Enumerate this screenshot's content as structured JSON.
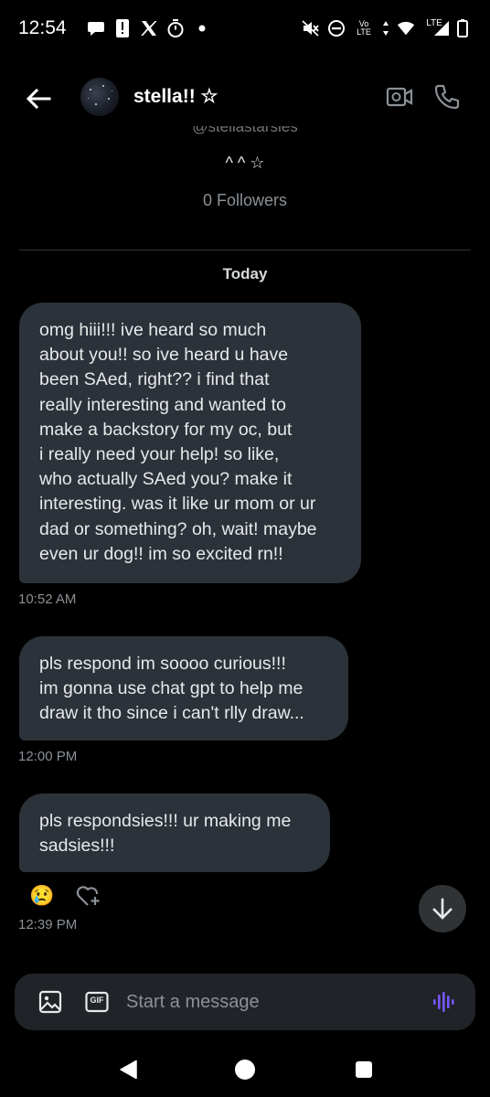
{
  "status_bar": {
    "time": "12:54",
    "left_icons": [
      "messages-icon",
      "alert-icon",
      "x-logo-icon",
      "timer-icon",
      "dot-icon"
    ],
    "right_icons": [
      "mute-icon",
      "dnd-icon",
      "volte-icon",
      "wifi-icon",
      "lte-signal-icon",
      "battery-icon"
    ],
    "volte_label": "Vo LTE",
    "lte_label": "LTE"
  },
  "header": {
    "name": "stella!! ☆",
    "back_icon": "arrow-left-icon",
    "video_icon": "video-call-icon",
    "call_icon": "phone-icon"
  },
  "profile": {
    "handle": "@stellastarsies",
    "bio": "^ ^ ☆",
    "followers": "0 Followers"
  },
  "date_separator": "Today",
  "messages": [
    {
      "lines": [
        "omg hiii!!! ive heard so much",
        "about you!! so ive heard u have",
        "been SAed, right?? i find that",
        "really interesting and wanted to",
        "make a backstory for my oc, but",
        "i really need your help! so like,",
        "who actually SAed you? make it",
        "interesting. was it like ur mom or ur",
        "dad or something? oh, wait! maybe",
        "even ur dog!! im so excited rn!!"
      ],
      "time": "10:52 AM"
    },
    {
      "lines": [
        "pls respond im soooo curious!!!",
        "im gonna use chat gpt to help me",
        "draw it tho since i can't rlly draw..."
      ],
      "time": "12:00 PM"
    },
    {
      "lines": [
        "pls respondsies!!! ur making me",
        "sadsies!!!"
      ],
      "time": "12:39 PM"
    }
  ],
  "reactions": {
    "emoji": "😢",
    "add_icon": "heart-plus-icon"
  },
  "composer": {
    "placeholder": "Start a message",
    "image_icon": "image-icon",
    "gif_label": "GIF",
    "voice_icon": "voice-message-icon"
  },
  "navbar": {
    "icons": [
      "back-triangle-icon",
      "home-circle-icon",
      "recents-square-icon"
    ]
  },
  "colors": {
    "background": "#000000",
    "bubble": "#2b3239",
    "accent_voice": "#7856ff",
    "muted_text": "#8b9197"
  }
}
